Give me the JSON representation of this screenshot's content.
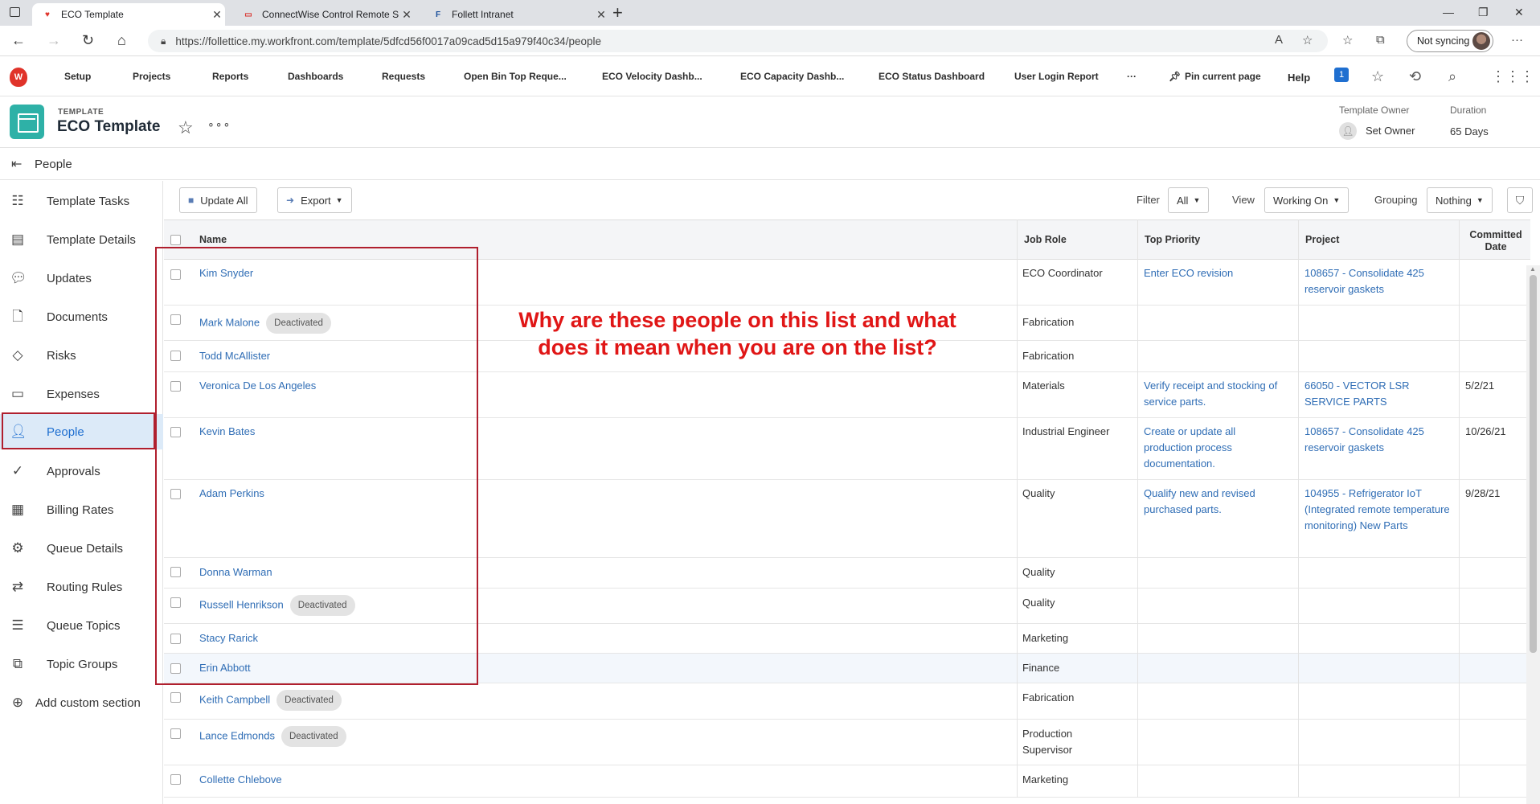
{
  "browser": {
    "tabs": [
      {
        "title": "ECO Template",
        "icon": "workfront-icon"
      },
      {
        "title": "ConnectWise Control Remote Su",
        "icon": "connectwise-icon"
      },
      {
        "title": "Follett Intranet",
        "icon": "follett-icon"
      }
    ],
    "url": "https://follettice.my.workfront.com/template/5dfcd56f0017a09cad5d15a979f40c34/people",
    "sync_label": "Not syncing"
  },
  "appnav": {
    "items": [
      "Setup",
      "Projects",
      "Reports",
      "Dashboards",
      "Requests",
      "Open Bin Top Reque...",
      "ECO Velocity Dashb...",
      "ECO Capacity Dashb...",
      "ECO Status Dashboard",
      "User Login Report"
    ],
    "more": "···",
    "pin": "Pin current page",
    "help": "Help",
    "notification_count": "1"
  },
  "header": {
    "type_label": "TEMPLATE",
    "title": "ECO Template",
    "owner_label": "Template Owner",
    "owner_value": "Set Owner",
    "duration_label": "Duration",
    "duration_value": "65 Days"
  },
  "section": {
    "title": "People"
  },
  "sidebar": {
    "items": [
      {
        "label": "Template Tasks",
        "icon": "tasks-icon"
      },
      {
        "label": "Template Details",
        "icon": "details-icon"
      },
      {
        "label": "Updates",
        "icon": "comment-icon"
      },
      {
        "label": "Documents",
        "icon": "document-icon"
      },
      {
        "label": "Risks",
        "icon": "risk-icon"
      },
      {
        "label": "Expenses",
        "icon": "expenses-icon"
      },
      {
        "label": "People",
        "icon": "people-icon"
      },
      {
        "label": "Approvals",
        "icon": "approvals-icon"
      },
      {
        "label": "Billing Rates",
        "icon": "billing-icon"
      },
      {
        "label": "Queue Details",
        "icon": "queue-icon"
      },
      {
        "label": "Routing Rules",
        "icon": "routing-icon"
      },
      {
        "label": "Queue Topics",
        "icon": "topics-icon"
      },
      {
        "label": "Topic Groups",
        "icon": "topic-groups-icon"
      },
      {
        "label": "Add custom section",
        "icon": "add-icon"
      }
    ]
  },
  "toolbar": {
    "update_all": "Update All",
    "export": "Export",
    "filter_label": "Filter",
    "filter_value": "All",
    "view_label": "View",
    "view_value": "Working On",
    "grouping_label": "Grouping",
    "grouping_value": "Nothing"
  },
  "table": {
    "columns": [
      "Name",
      "Job Role",
      "Top Priority",
      "Project",
      "Committed Date"
    ],
    "rows": [
      {
        "name": "Kim Snyder",
        "badge": "",
        "role": "ECO Coordinator",
        "priority": "Enter ECO revision",
        "project": "108657 - Consolidate 425 reservoir gaskets",
        "date": ""
      },
      {
        "name": "Mark Malone",
        "badge": "Deactivated",
        "role": "Fabrication",
        "priority": "",
        "project": "",
        "date": ""
      },
      {
        "name": "Todd McAllister",
        "badge": "",
        "role": "Fabrication",
        "priority": "",
        "project": "",
        "date": ""
      },
      {
        "name": "Veronica De Los Angeles",
        "badge": "",
        "role": "Materials",
        "priority": "Verify receipt and stocking of service parts.",
        "project": "66050 - VECTOR LSR SERVICE PARTS",
        "date": "5/2/21"
      },
      {
        "name": "Kevin Bates",
        "badge": "",
        "role": "Industrial Engineer",
        "priority": "Create or update all production process documentation.",
        "project": "108657 - Consolidate 425 reservoir gaskets",
        "date": "10/26/21"
      },
      {
        "name": "Adam Perkins",
        "badge": "",
        "role": "Quality",
        "priority": "Qualify new and revised purchased parts.",
        "project": "104955 - Refrigerator IoT (Integrated remote temperature monitoring) New Parts",
        "date": "9/28/21"
      },
      {
        "name": "Donna Warman",
        "badge": "",
        "role": "Quality",
        "priority": "",
        "project": "",
        "date": ""
      },
      {
        "name": "Russell Henrikson",
        "badge": "Deactivated",
        "role": "Quality",
        "priority": "",
        "project": "",
        "date": ""
      },
      {
        "name": "Stacy Rarick",
        "badge": "",
        "role": "Marketing",
        "priority": "",
        "project": "",
        "date": ""
      },
      {
        "name": "Erin Abbott",
        "badge": "",
        "role": "Finance",
        "priority": "",
        "project": "",
        "date": ""
      },
      {
        "name": "Keith Campbell",
        "badge": "Deactivated",
        "role": "Fabrication",
        "priority": "",
        "project": "",
        "date": ""
      },
      {
        "name": "Lance Edmonds",
        "badge": "Deactivated",
        "role": "Production Supervisor",
        "priority": "",
        "project": "",
        "date": ""
      },
      {
        "name": "Collette Chlebove",
        "badge": "",
        "role": "Marketing",
        "priority": "",
        "project": "",
        "date": ""
      }
    ]
  },
  "annotation": "Why are these people on this list and what does it mean when you are on the list?",
  "colors": {
    "accent": "#1f6fd0",
    "link": "#2f6db5",
    "annotation_red": "#e01616",
    "highlight_box": "#b01f2e",
    "template_icon": "#2eb1a7"
  }
}
